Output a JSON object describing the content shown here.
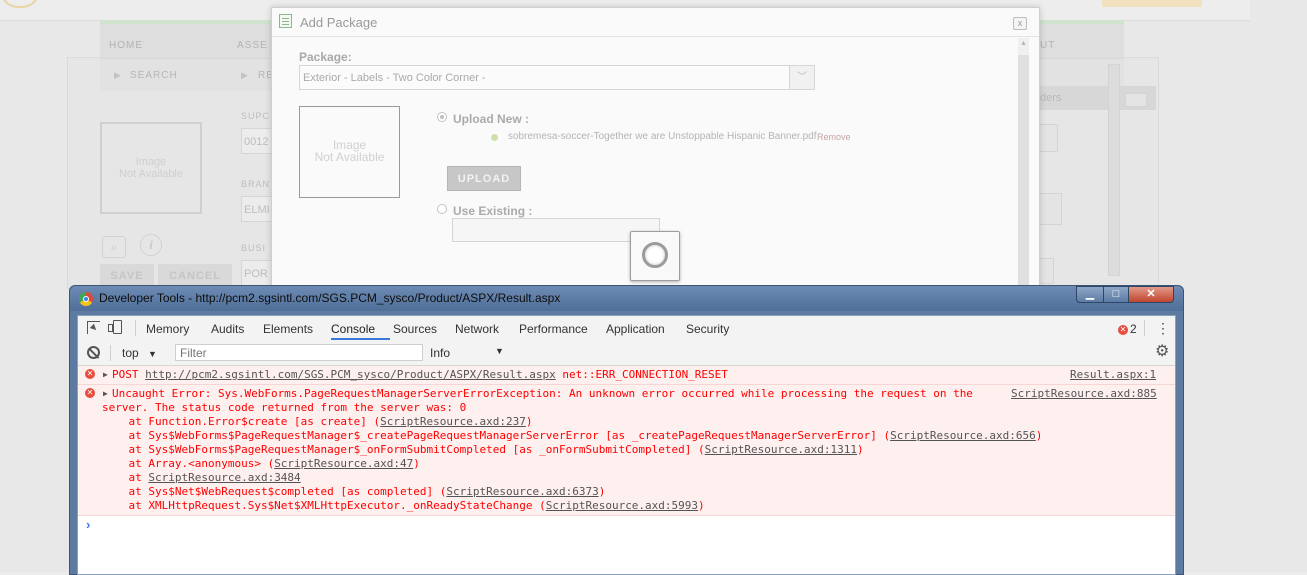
{
  "background": {
    "nav": {
      "home": "HOME",
      "asse": "ASSE",
      "ut": "UT"
    },
    "subnav": {
      "search": "SEARCH",
      "re": "RE"
    },
    "image_placeholder": [
      "Image",
      "Not Available"
    ],
    "labels": {
      "supc": "SUPC",
      "bran": "BRAN",
      "busi": "BUSI"
    },
    "fields": {
      "supc_val": "0012",
      "bran_val": "ELMI",
      "busi_val": "POR"
    },
    "buttons": {
      "save": "SAVE",
      "cancel": "CANCEL"
    },
    "right_panel_label": "ders"
  },
  "modal": {
    "title": "Add Package",
    "package_label": "Package:",
    "package_value": "Exterior - Labels - Two Color Corner -",
    "image_placeholder": [
      "Image",
      "Not Available"
    ],
    "upload_new_label": "Upload New :",
    "file_name": "sobremesa-soccer-Together we are Unstoppable Hispanic Banner.pdf",
    "file_remove": "Remove",
    "upload_button": "UPLOAD",
    "use_existing_label": "Use Existing :",
    "close_glyph": "x"
  },
  "devtools": {
    "window_title": "Developer Tools - http://pcm2.sgsintl.com/SGS.PCM_sysco/Product/ASPX/Result.aspx",
    "window_buttons": {
      "min": "▁",
      "max": "□",
      "close": "✕"
    },
    "tabs": [
      "Memory",
      "Audits",
      "Elements",
      "Console",
      "Sources",
      "Network",
      "Performance",
      "Application",
      "Security"
    ],
    "active_tab": "Console",
    "error_count": "2",
    "context": "top",
    "filter_placeholder": "Filter",
    "level": "Info",
    "messages": [
      {
        "text_prefix": "POST ",
        "url": "http://pcm2.sgsintl.com/SGS.PCM_sysco/Product/ASPX/Result.aspx",
        "text_suffix": " net::ERR_CONNECTION_RESET",
        "source": "Result.aspx:1"
      },
      {
        "line1": "Uncaught Error: Sys.WebForms.PageRequestManagerServerErrorException: An unknown error occurred while processing the request on the",
        "line2": "server. The status code returned from the server was: 0",
        "source": "ScriptResource.axd:885",
        "stack": [
          {
            "pre": "    at Function.Error$create [as create] (",
            "link": "ScriptResource.axd:237",
            "post": ")"
          },
          {
            "pre": "    at Sys$WebForms$PageRequestManager$_createPageRequestManagerServerError [as _createPageRequestManagerServerError] (",
            "link": "ScriptResource.axd:656",
            "post": ")"
          },
          {
            "pre": "    at Sys$WebForms$PageRequestManager$_onFormSubmitCompleted [as _onFormSubmitCompleted] (",
            "link": "ScriptResource.axd:1311",
            "post": ")"
          },
          {
            "pre": "    at Array.<anonymous> (",
            "link": "ScriptResource.axd:47",
            "post": ")"
          },
          {
            "pre": "    at ",
            "link": "ScriptResource.axd:3484",
            "post": ""
          },
          {
            "pre": "    at Sys$Net$WebRequest$completed [as completed] (",
            "link": "ScriptResource.axd:6373",
            "post": ")"
          },
          {
            "pre": "    at XMLHttpRequest.Sys$Net$XMLHttpExecutor._onReadyStateChange (",
            "link": "ScriptResource.axd:5993",
            "post": ")"
          }
        ]
      }
    ],
    "prompt": "›"
  },
  "colors": {
    "error_red": "#ff0000",
    "error_bg": "#fff0f0",
    "accent_blue": "#3879d9",
    "window_chrome": "#5d7aa0"
  }
}
